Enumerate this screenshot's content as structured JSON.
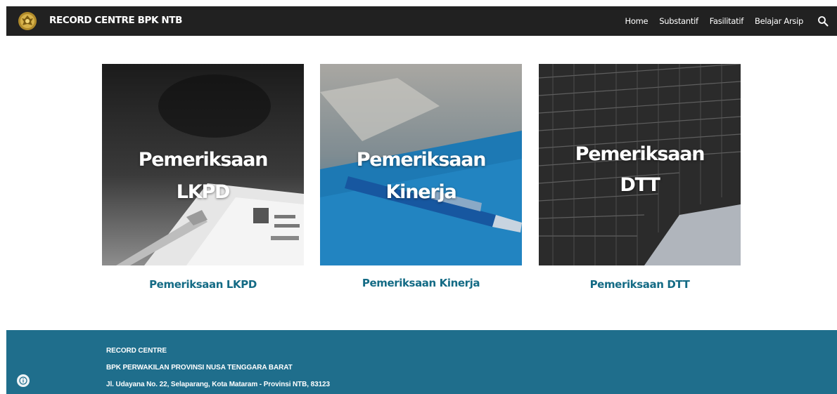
{
  "header": {
    "site_title": "RECORD CENTRE BPK NTB",
    "nav": [
      "Home",
      "Substantif",
      "Fasilitatif",
      "Belajar Arsip"
    ],
    "search_icon": "search-icon",
    "logo_icon": "bpk-emblem-icon"
  },
  "cards": [
    {
      "overlay_line1": "Pemeriksaan",
      "overlay_line2": "LKPD",
      "caption": "Pemeriksaan LKPD"
    },
    {
      "overlay_line1": "Pemeriksaan",
      "overlay_line2": "Kinerja",
      "caption": "Pemeriksaan Kinerja"
    },
    {
      "overlay_line1": "Pemeriksaan",
      "overlay_line2": "DTT",
      "caption": "Pemeriksaan DTT"
    }
  ],
  "footer": {
    "line1": "RECORD CENTRE",
    "line2": "BPK PERWAKILAN PROVINSI NUSA TENGGARA BARAT",
    "line3": "Jl. Udayana No. 22, Selaparang, Kota Mataram - Provinsi NTB, 83123",
    "info_icon": "info-icon"
  },
  "colors": {
    "header_bg": "#212121",
    "caption": "#146b85",
    "footer_bg": "#1f6e8c"
  }
}
